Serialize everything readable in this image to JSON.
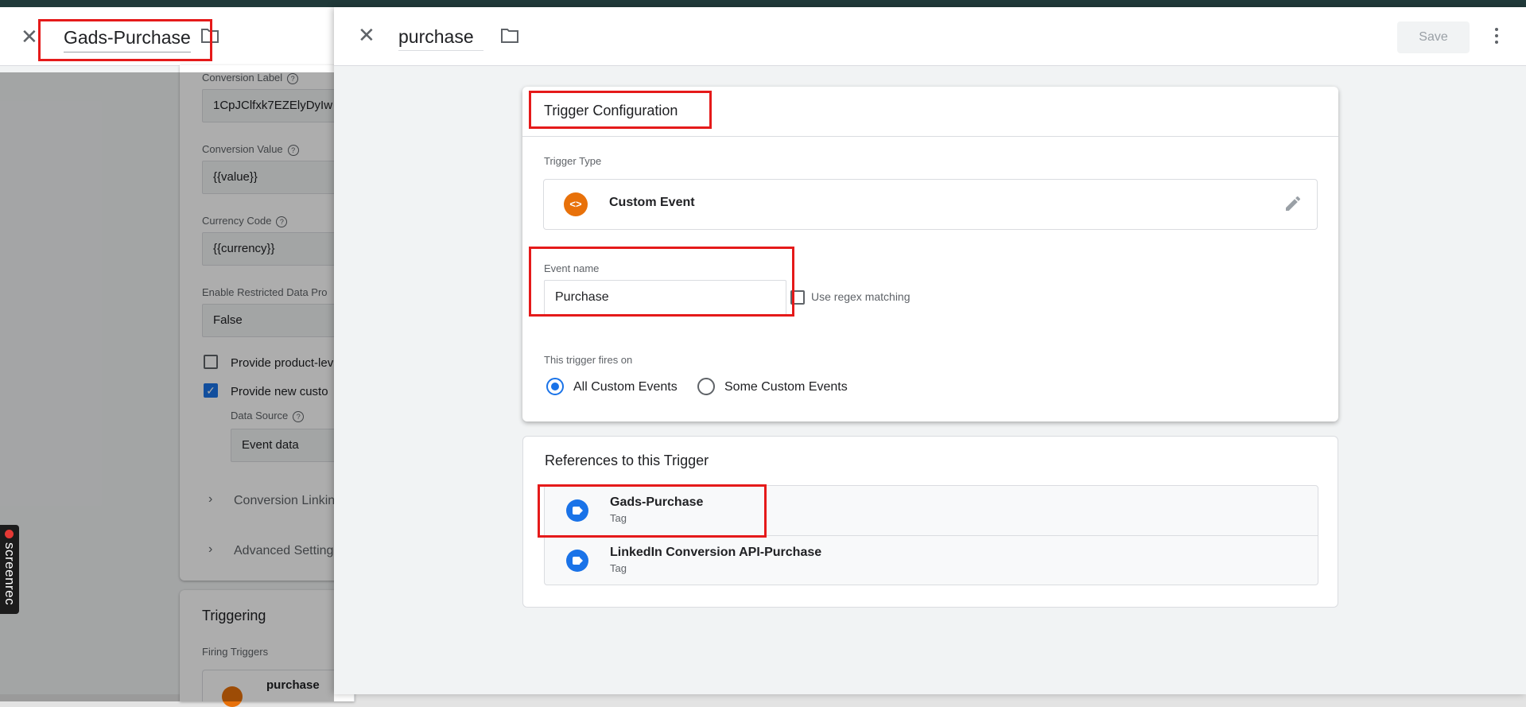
{
  "background_tag": {
    "title": "Gads-Purchase",
    "fields": {
      "conversion_label": {
        "label": "Conversion Label",
        "value": "1CpJClfxk7EZElyDyIw"
      },
      "conversion_value": {
        "label": "Conversion Value",
        "value": "{{value}}"
      },
      "currency_code": {
        "label": "Currency Code",
        "value": "{{currency}}"
      },
      "restricted_data": {
        "label": "Enable Restricted Data Pro",
        "value": "False"
      }
    },
    "checkboxes": [
      {
        "label": "Provide product-lev",
        "checked": false
      },
      {
        "label": "Provide new custo",
        "checked": true
      }
    ],
    "data_source": {
      "label": "Data Source",
      "value": "Event data"
    },
    "sections": [
      "Conversion Linkin",
      "Advanced Setting"
    ],
    "triggering": {
      "title": "Triggering",
      "label": "Firing Triggers",
      "trigger": "purchase"
    }
  },
  "panel": {
    "title": "purchase",
    "save_label": "Save",
    "config": {
      "title": "Trigger Configuration",
      "trigger_type_label": "Trigger Type",
      "trigger_type": "Custom Event",
      "event_name_label": "Event name",
      "event_name": "Purchase",
      "regex_label": "Use regex matching",
      "fires_on_label": "This trigger fires on",
      "options": [
        "All Custom Events",
        "Some Custom Events"
      ],
      "selected": "All Custom Events"
    },
    "references": {
      "title": "References to this Trigger",
      "items": [
        {
          "name": "Gads-Purchase",
          "type": "Tag"
        },
        {
          "name": "LinkedIn Conversion API-Purchase",
          "type": "Tag"
        }
      ]
    }
  },
  "watermark": "screenrec",
  "colors": {
    "highlight": "#e51a1a",
    "accent": "#1a73e8",
    "custom_event_icon": "#e8710a"
  }
}
